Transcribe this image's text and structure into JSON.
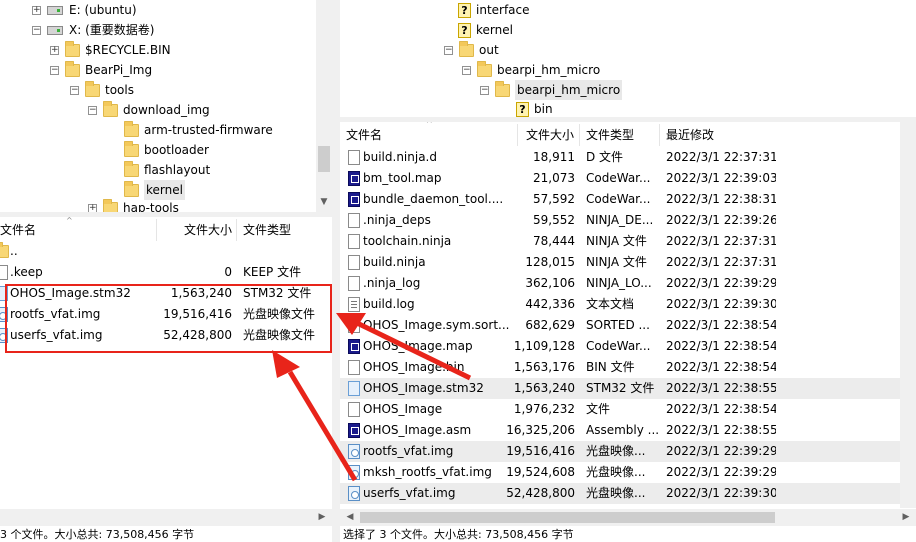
{
  "left_tree": {
    "items": [
      {
        "label": "E: (ubuntu)",
        "type": "drive"
      },
      {
        "label": "X: (重要数据卷)",
        "type": "drive"
      },
      {
        "label": "$RECYCLE.BIN",
        "type": "folder"
      },
      {
        "label": "BearPi_Img",
        "type": "folder"
      },
      {
        "label": "tools",
        "type": "folder"
      },
      {
        "label": "download_img",
        "type": "folder"
      },
      {
        "label": "arm-trusted-firmware",
        "type": "folder"
      },
      {
        "label": "bootloader",
        "type": "folder"
      },
      {
        "label": "flashlayout",
        "type": "folder"
      },
      {
        "label": "kernel",
        "type": "folder",
        "selected": true
      },
      {
        "label": "hap-tools",
        "type": "folder"
      }
    ]
  },
  "right_tree": {
    "items": [
      {
        "label": "interface",
        "type": "unknown"
      },
      {
        "label": "kernel",
        "type": "unknown"
      },
      {
        "label": "out",
        "type": "folder"
      },
      {
        "label": "bearpi_hm_micro",
        "type": "folder"
      },
      {
        "label": "bearpi_hm_micro",
        "type": "folder",
        "selected": true
      },
      {
        "label": "bin",
        "type": "unknown"
      }
    ]
  },
  "left_list": {
    "columns": {
      "name": "文件名",
      "size": "文件大小",
      "type": "文件类型"
    },
    "rows": [
      {
        "name": "..",
        "size": "",
        "type": ""
      },
      {
        "name": ".keep",
        "size": "0",
        "type": "KEEP 文件"
      },
      {
        "name": "OHOS_Image.stm32",
        "size": "1,563,240",
        "type": "STM32 文件"
      },
      {
        "name": "rootfs_vfat.img",
        "size": "19,516,416",
        "type": "光盘映像文件"
      },
      {
        "name": "userfs_vfat.img",
        "size": "52,428,800",
        "type": "光盘映像文件"
      }
    ],
    "status": "3 个文件。大小总共: 73,508,456 字节"
  },
  "right_list": {
    "columns": {
      "name": "文件名",
      "size": "文件大小",
      "type": "文件类型",
      "modified": "最近修改"
    },
    "rows": [
      {
        "name": "build.ninja.d",
        "size": "18,911",
        "type": "D 文件",
        "modified": "2022/3/1 22:37:31",
        "icon": "file"
      },
      {
        "name": "bm_tool.map",
        "size": "21,073",
        "type": "CodeWar...",
        "modified": "2022/3/1 22:39:03",
        "icon": "map"
      },
      {
        "name": "bundle_daemon_tool....",
        "size": "57,592",
        "type": "CodeWar...",
        "modified": "2022/3/1 22:38:31",
        "icon": "map"
      },
      {
        "name": ".ninja_deps",
        "size": "59,552",
        "type": "NINJA_DE...",
        "modified": "2022/3/1 22:39:26",
        "icon": "file"
      },
      {
        "name": "toolchain.ninja",
        "size": "78,444",
        "type": "NINJA 文件",
        "modified": "2022/3/1 22:37:31",
        "icon": "file"
      },
      {
        "name": "build.ninja",
        "size": "128,015",
        "type": "NINJA 文件",
        "modified": "2022/3/1 22:37:31",
        "icon": "file"
      },
      {
        "name": ".ninja_log",
        "size": "362,106",
        "type": "NINJA_LO...",
        "modified": "2022/3/1 22:39:29",
        "icon": "file"
      },
      {
        "name": "build.log",
        "size": "442,336",
        "type": "文本文档",
        "modified": "2022/3/1 22:39:30",
        "icon": "log"
      },
      {
        "name": "OHOS_Image.sym.sort...",
        "size": "682,629",
        "type": "SORTED ...",
        "modified": "2022/3/1 22:38:54",
        "icon": "file"
      },
      {
        "name": "OHOS_Image.map",
        "size": "1,109,128",
        "type": "CodeWar...",
        "modified": "2022/3/1 22:38:54",
        "icon": "map"
      },
      {
        "name": "OHOS_Image.bin",
        "size": "1,563,176",
        "type": "BIN 文件",
        "modified": "2022/3/1 22:38:54",
        "icon": "file"
      },
      {
        "name": "OHOS_Image.stm32",
        "size": "1,563,240",
        "type": "STM32 文件",
        "modified": "2022/3/1 22:38:55",
        "icon": "stm",
        "selected": true
      },
      {
        "name": "OHOS_Image",
        "size": "1,976,232",
        "type": "文件",
        "modified": "2022/3/1 22:38:54",
        "icon": "file"
      },
      {
        "name": "OHOS_Image.asm",
        "size": "16,325,206",
        "type": "Assembly ...",
        "modified": "2022/3/1 22:38:55",
        "icon": "map"
      },
      {
        "name": "rootfs_vfat.img",
        "size": "19,516,416",
        "type": "光盘映像...",
        "modified": "2022/3/1 22:39:29",
        "icon": "img",
        "selected": true
      },
      {
        "name": "mksh_rootfs_vfat.img",
        "size": "19,524,608",
        "type": "光盘映像...",
        "modified": "2022/3/1 22:39:29",
        "icon": "img"
      },
      {
        "name": "userfs_vfat.img",
        "size": "52,428,800",
        "type": "光盘映像...",
        "modified": "2022/3/1 22:39:30",
        "icon": "img",
        "selected": true
      }
    ],
    "status": "选择了 3 个文件。大小总共: 73,508,456 字节"
  },
  "colors": {
    "annotation_red": "#e8241a",
    "selected_row": "#ececec",
    "folder": "#f8d775"
  }
}
